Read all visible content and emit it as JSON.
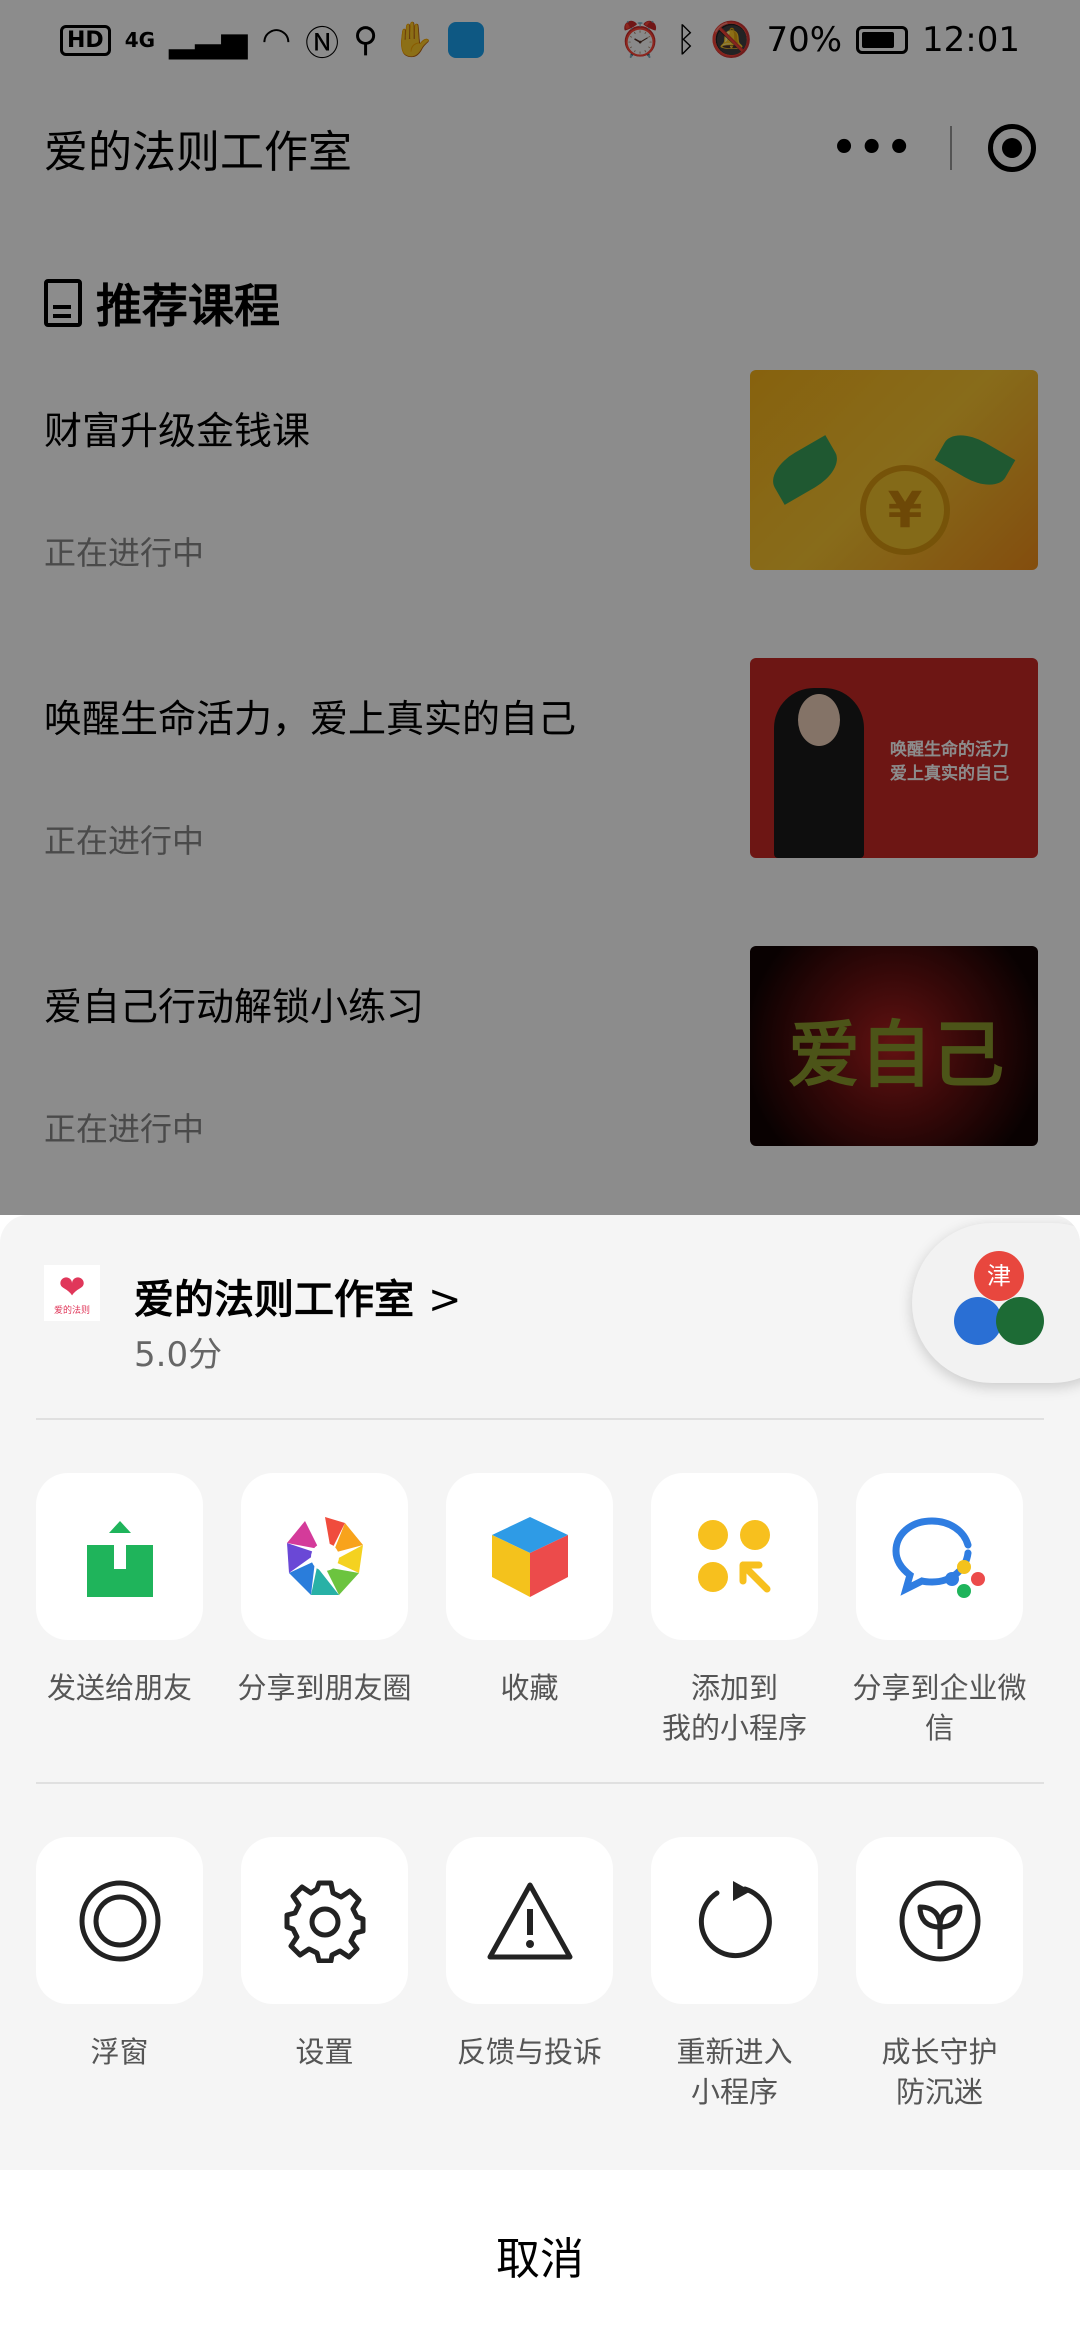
{
  "status_bar": {
    "left": {
      "hd": "HD",
      "network": "4G"
    },
    "right": {
      "battery": "70%",
      "time": "12:01"
    },
    "icons": [
      "hd-icon",
      "signal-icon",
      "wifi-icon",
      "nfc-icon",
      "app-icon",
      "hand-icon",
      "flyer-app-icon",
      "alarm-icon",
      "bluetooth-icon",
      "mute-icon",
      "battery-icon"
    ]
  },
  "nav": {
    "title": "爱的法则工作室"
  },
  "section": {
    "title": "推荐课程"
  },
  "courses": [
    {
      "title": "财富升级金钱课",
      "status": "正在进行中",
      "thumb_icon": "coin-icon"
    },
    {
      "title": "唤醒生命活力，爱上真实的自己",
      "status": "正在进行中",
      "thumb_caption": "唤醒生命的活力\n爱上真实的自己"
    },
    {
      "title": "爱自己行动解锁小练习",
      "status": "正在进行中",
      "thumb_caption": "爱自己"
    }
  ],
  "sheet": {
    "app_name": "爱的法则工作室",
    "chevron": ">",
    "rating": "5.0分",
    "logo_text": "爱的法则",
    "float_bubble_char": "津",
    "row1": [
      {
        "label": "发送给朋友",
        "icon": "send-to-friend-icon"
      },
      {
        "label": "分享到朋友圈",
        "icon": "moments-icon"
      },
      {
        "label": "收藏",
        "icon": "favorite-icon"
      },
      {
        "label": "添加到\n我的小程序",
        "icon": "add-to-my-miniprogram-icon"
      },
      {
        "label": "分享到企业微信",
        "icon": "wecom-icon"
      }
    ],
    "row2": [
      {
        "label": "浮窗",
        "icon": "float-window-icon"
      },
      {
        "label": "设置",
        "icon": "settings-gear-icon"
      },
      {
        "label": "反馈与投诉",
        "icon": "warning-icon"
      },
      {
        "label": "重新进入\n小程序",
        "icon": "reload-icon"
      },
      {
        "label": "成长守护\n防沉迷",
        "icon": "sprout-icon"
      }
    ],
    "cancel": "取消"
  },
  "colors": {
    "wechat_green": "#1fb45b",
    "accent_yellow": "#f7c01e",
    "wecom_blue": "#2f7de1"
  }
}
